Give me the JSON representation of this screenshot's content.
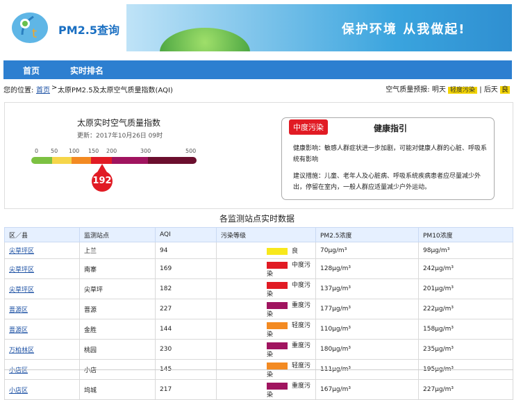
{
  "site": {
    "logo_text": "PM2.5查询"
  },
  "banner": {
    "slogan": "保护环境 从我做起!"
  },
  "nav": {
    "items": [
      {
        "label": "首页"
      },
      {
        "label": "实时排名"
      }
    ]
  },
  "breadcrumb": {
    "prefix": "您的位置:",
    "home": "首页",
    "sep": ">",
    "current": "太原PM2.5及太原空气质量指数(AQI)"
  },
  "forecast": {
    "label": "空气质量预报:",
    "tomorrow_label": "明天",
    "tomorrow_value": "轻度污染",
    "sep": "|",
    "dayafter_label": "后天",
    "dayafter_value": "良"
  },
  "aqi": {
    "title": "太原实时空气质量指数",
    "updated": "更新：2017年10月26日 09时",
    "value": 192,
    "scale_labels": [
      "0",
      "50",
      "100",
      "150",
      "200",
      "300",
      "500"
    ],
    "scale_colors": [
      "#7cc142",
      "#f6d64a",
      "#f38a22",
      "#e11b24",
      "#a0145f",
      "#6b0f2e"
    ]
  },
  "guide": {
    "tag": "中度污染",
    "title": "健康指引",
    "health_text": "健康影响：敏感人群症状进一步加剧，可能对健康人群的心脏、呼吸系统有影响",
    "advice_text": "建议措施：儿童、老年人及心脏病、呼吸系统疾病患者应尽量减少外出，停留在室内，一般人群应适量减少户外运动。"
  },
  "table": {
    "title": "各监测站点实时数据",
    "headers": [
      "区／县",
      "监测站点",
      "AQI",
      "污染等级",
      "PM2.5浓度",
      "PM10浓度"
    ],
    "rows": [
      {
        "district": "尖草坪区",
        "station": "上兰",
        "aqi": "94",
        "level": "良",
        "pm25": "70μg/m³",
        "pm10": "98μg/m³",
        "color": "#f8e81c"
      },
      {
        "district": "尖草坪区",
        "station": "南寨",
        "aqi": "169",
        "level": "中度污染",
        "pm25": "128μg/m³",
        "pm10": "242μg/m³",
        "color": "#e11b24"
      },
      {
        "district": "尖草坪区",
        "station": "尖草坪",
        "aqi": "182",
        "level": "中度污染",
        "pm25": "137μg/m³",
        "pm10": "201μg/m³",
        "color": "#e11b24"
      },
      {
        "district": "晋源区",
        "station": "晋源",
        "aqi": "227",
        "level": "重度污染",
        "pm25": "177μg/m³",
        "pm10": "222μg/m³",
        "color": "#a0145f"
      },
      {
        "district": "晋源区",
        "station": "金胜",
        "aqi": "144",
        "level": "轻度污染",
        "pm25": "110μg/m³",
        "pm10": "158μg/m³",
        "color": "#f38a22"
      },
      {
        "district": "万柏林区",
        "station": "桃园",
        "aqi": "230",
        "level": "重度污染",
        "pm25": "180μg/m³",
        "pm10": "235μg/m³",
        "color": "#a0145f"
      },
      {
        "district": "小店区",
        "station": "小店",
        "aqi": "145",
        "level": "轻度污染",
        "pm25": "111μg/m³",
        "pm10": "195μg/m³",
        "color": "#f38a22"
      },
      {
        "district": "小店区",
        "station": "坞城",
        "aqi": "217",
        "level": "重度污染",
        "pm25": "167μg/m³",
        "pm10": "227μg/m³",
        "color": "#a0145f"
      }
    ]
  }
}
